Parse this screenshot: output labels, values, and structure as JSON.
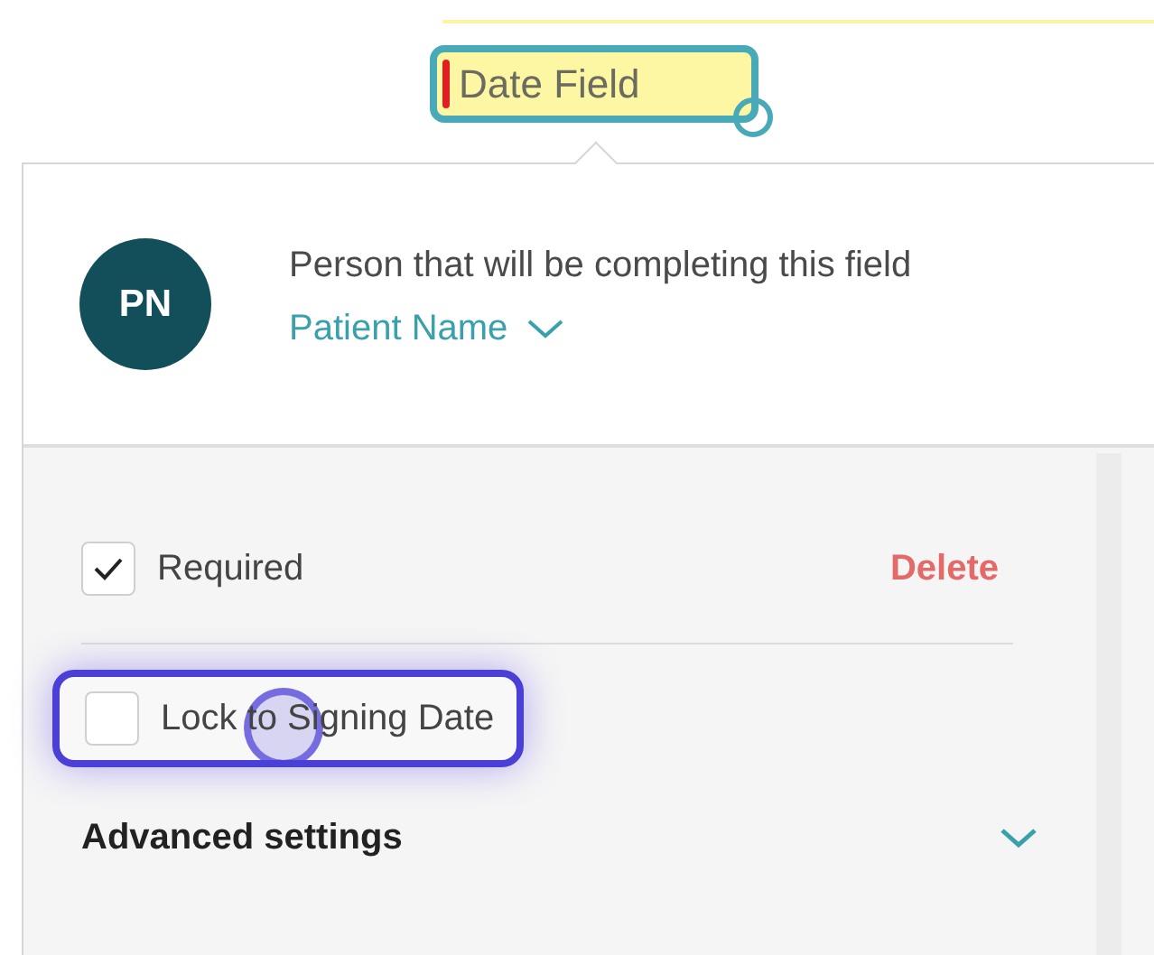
{
  "field_chip": {
    "label": "Date Field",
    "selected": true
  },
  "assignee": {
    "initials": "PN",
    "caption": "Person that will be completing this field",
    "name": "Patient Name"
  },
  "options": [
    {
      "label": "Required",
      "checked": true,
      "highlighted": false
    },
    {
      "label": "Lock to Signing Date",
      "checked": false,
      "highlighted": true
    }
  ],
  "delete_label": "Delete",
  "advanced": {
    "label": "Advanced settings",
    "expanded": false
  }
}
